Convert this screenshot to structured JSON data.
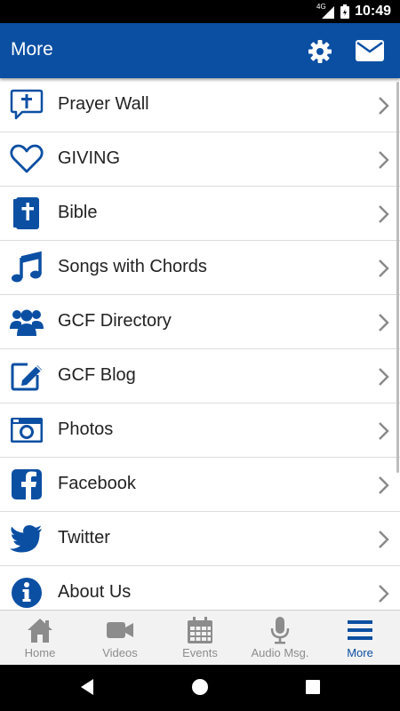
{
  "status_bar": {
    "network": "4G",
    "time": "10:49"
  },
  "app_bar": {
    "title": "More",
    "settings_icon": "gear-icon",
    "mail_icon": "mail-icon"
  },
  "menu": [
    {
      "label": "Prayer Wall",
      "icon": "prayer-chat-icon"
    },
    {
      "label": "GIVING",
      "icon": "heart-icon"
    },
    {
      "label": "Bible",
      "icon": "bible-icon"
    },
    {
      "label": "Songs with Chords",
      "icon": "music-note-icon"
    },
    {
      "label": "GCF Directory",
      "icon": "people-icon"
    },
    {
      "label": "GCF Blog",
      "icon": "edit-icon"
    },
    {
      "label": "Photos",
      "icon": "camera-icon"
    },
    {
      "label": "Facebook",
      "icon": "facebook-icon"
    },
    {
      "label": "Twitter",
      "icon": "twitter-icon"
    },
    {
      "label": "About Us",
      "icon": "info-icon"
    }
  ],
  "tabs": [
    {
      "label": "Home",
      "icon": "home-icon",
      "active": false
    },
    {
      "label": "Videos",
      "icon": "video-camera-icon",
      "active": false
    },
    {
      "label": "Events",
      "icon": "calendar-icon",
      "active": false
    },
    {
      "label": "Audio Msg.",
      "icon": "microphone-icon",
      "active": false
    },
    {
      "label": "More",
      "icon": "menu-icon",
      "active": true
    }
  ],
  "colors": {
    "accent": "#0b4fa3",
    "tab_inactive": "#8c8c8c",
    "tab_bar_bg": "#f2f2f2"
  }
}
